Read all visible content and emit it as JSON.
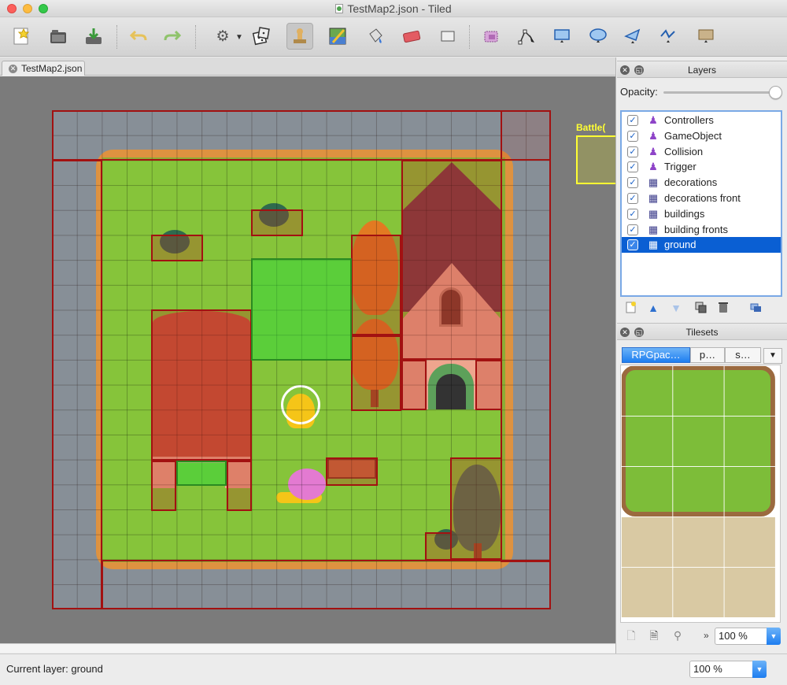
{
  "window": {
    "title": "TestMap2.json - Tiled"
  },
  "toolbar": {
    "buttons": [
      {
        "name": "new-map",
        "icon": "new-document-icon"
      },
      {
        "name": "open",
        "icon": "folder-icon"
      },
      {
        "name": "save",
        "icon": "save-icon"
      },
      {
        "name": "undo",
        "icon": "undo-icon"
      },
      {
        "name": "redo",
        "icon": "redo-icon"
      },
      {
        "name": "commands",
        "icon": "gears-icon"
      },
      {
        "name": "random-mode",
        "icon": "dice-icon"
      },
      {
        "name": "stamp-brush",
        "icon": "stamp-icon"
      },
      {
        "name": "terrain-brush",
        "icon": "terrain-icon"
      },
      {
        "name": "bucket-fill",
        "icon": "bucket-icon"
      },
      {
        "name": "eraser",
        "icon": "eraser-icon"
      },
      {
        "name": "rect-select",
        "icon": "rect-select-icon"
      },
      {
        "name": "select-same-tile",
        "icon": "magic-wand-icon"
      },
      {
        "name": "edit-polygons",
        "icon": "edit-polygon-icon"
      },
      {
        "name": "insert-rectangle",
        "icon": "rectangle-icon"
      },
      {
        "name": "insert-ellipse",
        "icon": "ellipse-icon"
      },
      {
        "name": "insert-polygon",
        "icon": "polygon-icon"
      },
      {
        "name": "insert-polyline",
        "icon": "polyline-icon"
      },
      {
        "name": "insert-tile",
        "icon": "insert-tile-icon"
      }
    ]
  },
  "document_tab": {
    "label": "TestMap2.json"
  },
  "map": {
    "object_label": "Battle("
  },
  "layers_panel": {
    "title": "Layers",
    "opacity_label": "Opacity:",
    "opacity": 1.0,
    "layers": [
      {
        "label": "Controllers",
        "type": "object",
        "checked": true
      },
      {
        "label": "GameObject",
        "type": "object",
        "checked": true
      },
      {
        "label": "Collision",
        "type": "object",
        "checked": true
      },
      {
        "label": "Trigger",
        "type": "object",
        "checked": true
      },
      {
        "label": "decorations",
        "type": "tile",
        "checked": true
      },
      {
        "label": "decorations front",
        "type": "tile",
        "checked": true
      },
      {
        "label": "buildings",
        "type": "tile",
        "checked": true
      },
      {
        "label": "building fronts",
        "type": "tile",
        "checked": true
      },
      {
        "label": "ground",
        "type": "tile",
        "checked": true,
        "selected": true
      }
    ]
  },
  "tilesets_panel": {
    "title": "Tilesets",
    "tabs": [
      "RPGpac…",
      "p…",
      "s…"
    ],
    "zoom": "100 %",
    "zoom_prefix": "»"
  },
  "status": {
    "current_layer": "Current layer: ground",
    "zoom": "100 %"
  },
  "colors": {
    "accent": "#0a5fd3",
    "collision": "#a21111",
    "trigger": "#2a8a21",
    "label": "#ffff33"
  }
}
